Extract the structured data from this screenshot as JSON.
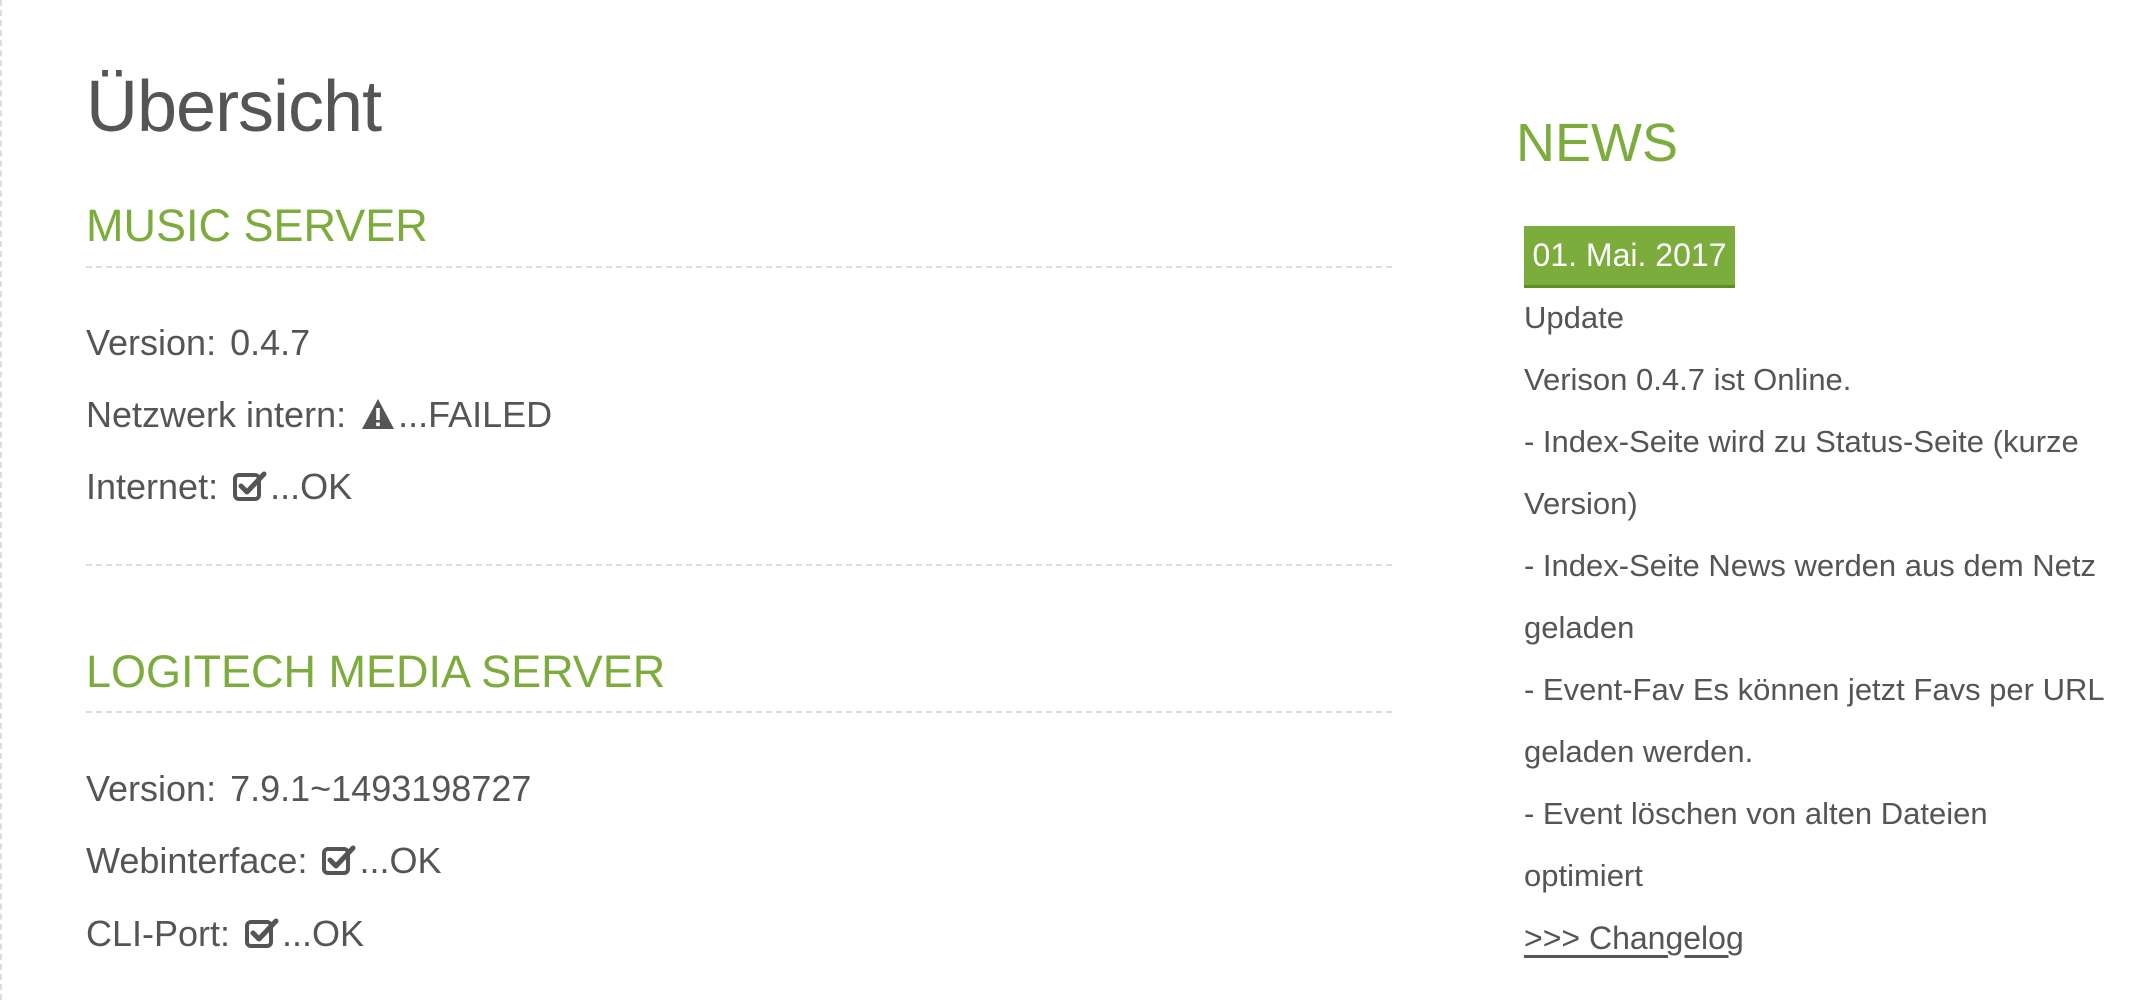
{
  "page": {
    "title": "Übersicht"
  },
  "music_server": {
    "title": "MUSIC SERVER",
    "rows": [
      {
        "label": "Version:",
        "value": "0.4.7",
        "icon": ""
      },
      {
        "label": "Netzwerk intern:",
        "value": "...FAILED",
        "icon": "warning-icon"
      },
      {
        "label": "Internet:",
        "value": "...OK",
        "icon": "check-square-icon"
      }
    ]
  },
  "logitech_media_server": {
    "title": "LOGITECH MEDIA SERVER",
    "rows": [
      {
        "label": "Version:",
        "value": "7.9.1~1493198727",
        "icon": ""
      },
      {
        "label": "Webinterface:",
        "value": "...OK",
        "icon": "check-square-icon"
      },
      {
        "label": "CLI-Port:",
        "value": "...OK",
        "icon": "check-square-icon"
      }
    ]
  },
  "news": {
    "title": "NEWS",
    "date": "01. Mai. 2017",
    "lines": [
      "Update",
      "Verison 0.4.7 ist Online.",
      "- Index-Seite wird zu Status-Seite (kurze",
      "Version)",
      "- Index-Seite News werden aus dem Netz",
      "geladen",
      "- Event-Fav Es können jetzt Favs per URL",
      "geladen werden.",
      "- Event löschen von alten Dateien",
      "optimiert"
    ],
    "changelog_link": ">>> Changelog"
  },
  "colors": {
    "accent": "#7cac3b",
    "text": "#555555",
    "divider": "#dddddd"
  }
}
